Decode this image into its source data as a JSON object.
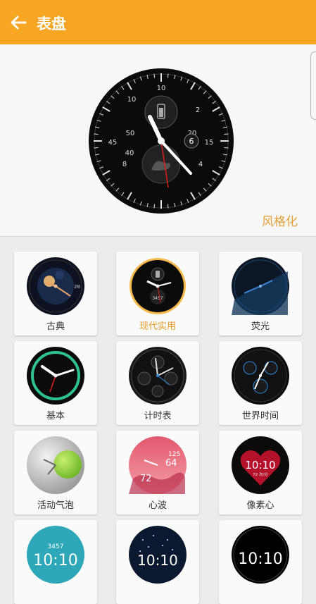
{
  "header": {
    "title": "表盘",
    "back_icon": "arrow-left-icon"
  },
  "preview": {
    "customize_label": "风格化"
  },
  "colors": {
    "accent": "#f6a623",
    "selected_text": "#e59b26"
  },
  "watch_faces": [
    {
      "label": "古典",
      "selected": false
    },
    {
      "label": "现代实用",
      "selected": true
    },
    {
      "label": "荧光",
      "selected": false
    },
    {
      "label": "基本",
      "selected": false
    },
    {
      "label": "计时表",
      "selected": false
    },
    {
      "label": "世界时间",
      "selected": false
    },
    {
      "label": "活动气泡",
      "selected": false
    },
    {
      "label": "心波",
      "selected": false
    },
    {
      "label": "像素心",
      "selected": false
    },
    {
      "label": "",
      "selected": false
    },
    {
      "label": "",
      "selected": false
    },
    {
      "label": "",
      "selected": false
    }
  ],
  "face_text": {
    "modern_numbers": [
      "10",
      "2",
      "4",
      "8",
      "50",
      "20",
      "40",
      "30",
      "45",
      "15",
      "6",
      "20"
    ],
    "thumb_date": "28",
    "thumb_steps": "3457",
    "wave_time_a": "125",
    "wave_time_b": "64",
    "wave_temp": "72",
    "pixel_time": "10:10",
    "pixel_sub": "72 次/分",
    "row4_time": "10:10",
    "row4_steps": "3457"
  }
}
